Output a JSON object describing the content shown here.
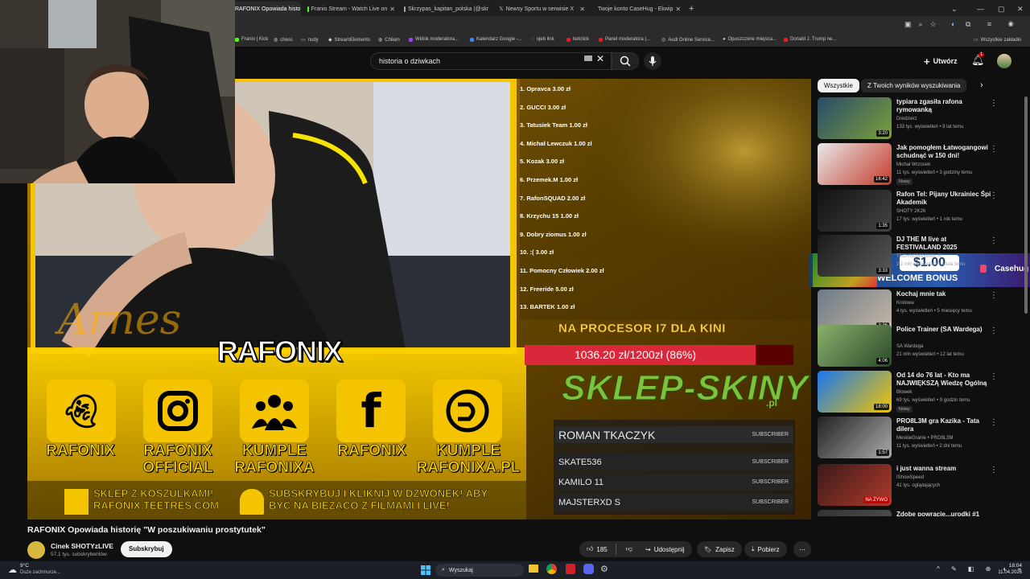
{
  "browser": {
    "tabs": [
      {
        "label": "RAFONIX Opowiada histo",
        "active": true
      },
      {
        "label": "Franio Stream - Watch Live on",
        "active": false
      },
      {
        "label": "Skrzypas_kapitan_polska (@skr",
        "active": false
      },
      {
        "label": "Newsy Sportu w serwisie X",
        "active": false
      },
      {
        "label": "Twoje konto CaseHug - Ekwip",
        "active": false
      }
    ],
    "bookmarks": [
      "Franio | Kick",
      "chesc",
      "nudy",
      "StreamElements",
      "Chiłam",
      "Widok moderatora...",
      "Kalendarz Google -...",
      "ujeb link",
      "betclick",
      "Panel moderatora |...",
      "Audi Online Service...",
      "Opuszczone miejsca...",
      "Donald J. Trump ne..."
    ],
    "bookmarks_all": "Wszystkie zakładki"
  },
  "youtube": {
    "search_query": "historia o dziwkach",
    "create_label": "Utwórz",
    "notification_count": "1"
  },
  "video": {
    "title": "RAFONIX Opowiada historię \"W poszukiwaniu prostytutek\"",
    "channel_name": "Cinek SHOTYzLIVE",
    "subscribers": "57,1 tys. subskrybentów",
    "subscribe_label": "Subskrybuj",
    "likes": "185",
    "share_label": "Udostępnij",
    "save_label": "Zapisz",
    "download_label": "Pobierz",
    "overlay": {
      "watermark": "Arnes",
      "name_banner": "RAFONIX",
      "donations": [
        "1. Opravca 3.00 zł",
        "2. GUCCI 3.00 zł",
        "3. Tatusiek Team 1.00 zł",
        "4. Michał Lewczuk 1.00 zł",
        "5. Kozak 3.00 zł",
        "6. Przemek.M 1.00 zł",
        "7. RafonSQUAD 2.00 zł",
        "8. Krzychu 15 1.00 zł",
        "9. Dobry ziomus 1.00 zł",
        "10. :( 3.00 zł",
        "11. Pomocny Człowiek 2.00 zł",
        "12. Freeride 5.00 zł",
        "13. BARTEK 1.00 zł"
      ],
      "goal_title": "NA PROCESOR I7 DLA KINI",
      "goal_progress": "1036.20 zł/1200zł (86%)",
      "goal_fraction": 0.86,
      "shop_logo": "SKLEP-SKINY",
      "shop_logo_tld": ".pl",
      "socials": [
        {
          "icon": "snapchat-icon",
          "label": "RAFONIX"
        },
        {
          "icon": "instagram-icon",
          "label": "RAFONIX OFFICIAL"
        },
        {
          "icon": "group-icon",
          "label": "KUMPLE RAFONIXA"
        },
        {
          "icon": "facebook-icon",
          "label": "RAFONIX"
        },
        {
          "icon": "discord-icon",
          "label": "KUMPLE RAFONIXA.PL"
        }
      ],
      "shop_text": "SKLEP Z KOSZULKAMI! RAFONIX.TEETRES.COM",
      "subscribe_text": "SUBSKRYBUJ I KLIKNIJ W DZWONEK! ABY BYĆ NA BIEŻĄCO Z FILMAMI I LIVE!",
      "subscribers_list": [
        {
          "name": "ROMAN TKACZYK",
          "tag": "SUBSCRIBER"
        },
        {
          "name": "SKATE536",
          "tag": "SUBSCRIBER"
        },
        {
          "name": "KAMILO 11",
          "tag": "SUBSCRIBER"
        },
        {
          "name": "MAJSTERXD S",
          "tag": "SUBSCRIBER"
        }
      ]
    }
  },
  "sidebar": {
    "chips": [
      "Wszystkie",
      "Z Twoich wyników wyszukiwania"
    ],
    "ad": {
      "amount": "$1.00",
      "text": "WELCOME BONUS",
      "brand": "Casehug"
    },
    "videos": [
      {
        "title": "typiara zgasiła rafona rymowanką",
        "channel": "Dredzierz",
        "meta": "133 tys. wyświetleń • 9 lat temu",
        "duration": "3:20",
        "badge": ""
      },
      {
        "title": "Jak pomogłem Łatwogangowi schudnąć w 150 dni!",
        "channel": "Michał Wrzosek",
        "meta": "11 tys. wyświetleń • 3 godziny temu",
        "duration": "16:42",
        "badge": "Nowy"
      },
      {
        "title": "Rafon Tel: Pijany Ukrainiec Śpi Akademik",
        "channel": "SHOTY 2K26",
        "meta": "17 tys. wyświetleń • 1 rok temu",
        "duration": "1:35",
        "badge": ""
      },
      {
        "title": "DJ THE M live at FESTIVALAND 2025",
        "channel": "TECHNOMINIMAL R",
        "meta": "2,2 mln wyświetleń • 4 lata temu",
        "duration": "3:33",
        "badge": ""
      },
      {
        "title": "Kochaj mnie tak",
        "channel": "Królowa",
        "meta": "4 tys. wyświetleń • 5 miesięcy temu",
        "duration": "3:36",
        "badge": ""
      },
      {
        "title": "Police Trainer (SA Wardega)",
        "channel": "SA Wardega",
        "meta": "21 mln wyświetleń • 12 lat temu",
        "duration": "4:06",
        "badge": ""
      },
      {
        "title": "Od 14 do 76 lat - Kto ma NAJWIĘKSZĄ Wiedzę Ogólną",
        "channel": "Blowek",
        "meta": "69 tys. wyświetleń • 9 godzin temu",
        "duration": "18:00",
        "badge": "Nowy"
      },
      {
        "title": "PRO8L3M gra Kazika - Tata dilera",
        "channel": "MeskieGranie • PRO8L3M",
        "meta": "11 tys. wyświetleń • 2 dni temu",
        "duration": "1:57",
        "badge": ""
      },
      {
        "title": "i just wanna stream",
        "channel": "IShowSpeed",
        "meta": "41 tys. oglądających",
        "duration": "NA ŻYWO",
        "badge": ""
      },
      {
        "title": "Zdobe powracie...urodki #1",
        "channel": "",
        "meta": "",
        "duration": "",
        "badge": ""
      }
    ]
  },
  "taskbar": {
    "weather_temp": "9°C",
    "weather_desc": "Duże zachmurze...",
    "search_placeholder": "Wyszukaj",
    "time": "18:04",
    "date": "11.04.2026"
  }
}
